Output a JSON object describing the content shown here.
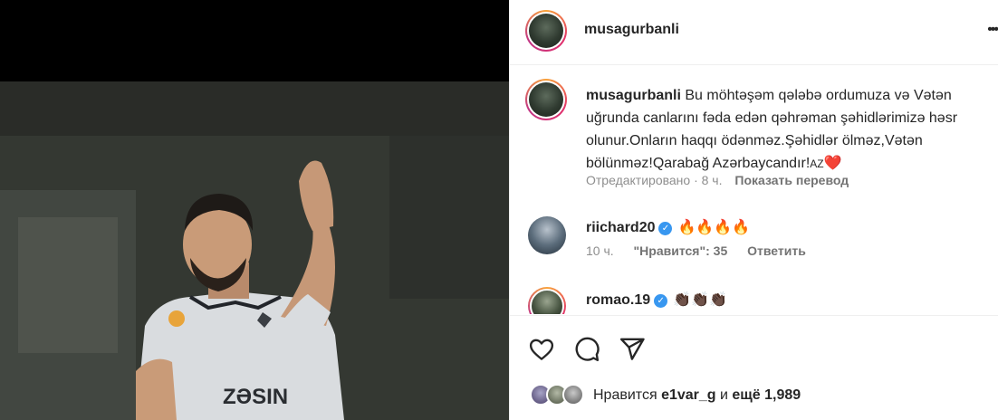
{
  "post": {
    "username": "musagurbanli",
    "more_label": "•••"
  },
  "caption": {
    "username": "musagurbanli",
    "text": "Bu möhtəşəm qələbə ordumuza və Vətən uğrunda canlarını fəda edən qəhrəman şəhidlərimizə həsr olunur.Onların haqqı ödənməz.Şəhidlər ölməz,Vətən bölünməz!Qarabağ Azərbaycandır!",
    "suffix": "AZ",
    "heart": "❤️",
    "edited": "Отредактировано · 8 ч.",
    "translate": "Показать перевод"
  },
  "comments": [
    {
      "username": "riichard20",
      "verified": true,
      "text": "🔥🔥🔥🔥",
      "time": "10 ч.",
      "likes": "\"Нравится\": 35",
      "reply": "Ответить"
    },
    {
      "username": "romao.19",
      "verified": true,
      "text": "👏🏿👏🏿👏🏿"
    }
  ],
  "footer": {
    "likes_prefix": "Нравится",
    "liked_by": "e1var_g",
    "and": "и",
    "others": "ещё 1,989"
  },
  "photo": {
    "jersey_text": "ZƏSIN"
  },
  "icons": {
    "like": "heart-icon",
    "comment": "comment-icon",
    "share": "share-icon",
    "verified_badge": "verified-icon"
  },
  "colors": {
    "accent_verified": "#3897f0",
    "heart": "#ed2b3a",
    "muted": "#8e8e8e"
  }
}
